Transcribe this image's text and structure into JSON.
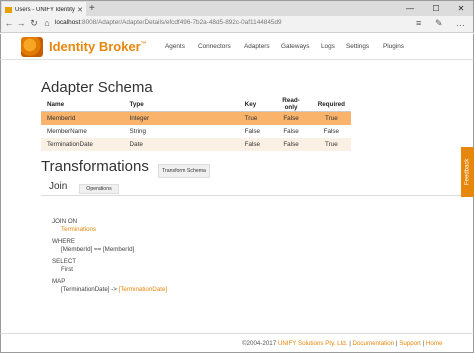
{
  "browser": {
    "tab_title": "Users - UNIFY Identity B",
    "tab_close": "✕",
    "new_tab": "+",
    "url_host": "localhost",
    "url_path": ":8008/Adapter/AdapterDetails/efcdf496-7b2a-48d5-892c-0af1144845d9",
    "controls": {
      "minimize": "—",
      "maximize": "☐",
      "close": "✕"
    },
    "nav": {
      "back": "←",
      "forward": "→",
      "refresh": "↻",
      "home": "⌂"
    },
    "right_icons": {
      "menu": "≡",
      "edit": "✎",
      "more": "…"
    }
  },
  "header": {
    "brand": "Identity Broker",
    "tm": "™",
    "nav": [
      "Agents",
      "Connectors",
      "Adapters",
      "Gateways",
      "Logs",
      "Settings",
      "Plugins"
    ]
  },
  "schema": {
    "title": "Adapter Schema",
    "columns": [
      "Name",
      "Type",
      "Key",
      "Read-only",
      "Required"
    ],
    "rows": [
      [
        "MemberId",
        "Integer",
        "True",
        "False",
        "True"
      ],
      [
        "MemberName",
        "String",
        "False",
        "False",
        "False"
      ],
      [
        "TerminationDate",
        "Date",
        "False",
        "False",
        "True"
      ]
    ]
  },
  "transformations": {
    "title": "Transformations",
    "transform_button": "Transform Schema",
    "tab_join": "Join",
    "tab_operations": "Operations",
    "code": {
      "join_on": "JOIN ON",
      "join_target": "Terminations",
      "where": "WHERE",
      "where_expr": "[MemberId] == [MemberId]",
      "select": "SELECT",
      "select_val": "First",
      "map": "MAP",
      "map_from": "[TerminationDate] -> ",
      "map_to": "[TerminationDate]"
    }
  },
  "feedback": "Feedback",
  "footer": {
    "copyright": "©2004-2017 ",
    "company": "UNIFY Solutions Pty. Ltd.",
    "sep": " | ",
    "documentation": "Documentation",
    "support": "Support",
    "home": "Home"
  },
  "colors": {
    "accent": "#e8870e",
    "selected_row": "#f9b36b"
  }
}
